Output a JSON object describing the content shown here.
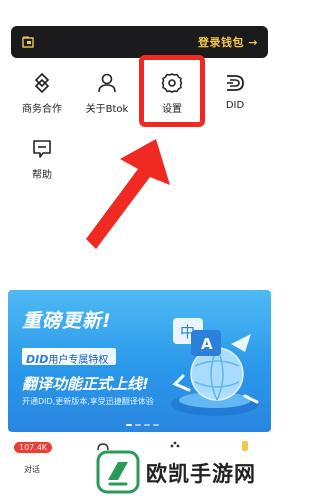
{
  "login_bar": {
    "text": "登录钱包 →"
  },
  "menu": [
    {
      "label": "商务合作",
      "icon": "diamond-icon"
    },
    {
      "label": "关于Btok",
      "icon": "person-icon"
    },
    {
      "label": "设置",
      "icon": "gear-icon"
    },
    {
      "label": "DID",
      "icon": "did-icon"
    },
    {
      "label": "帮助",
      "icon": "help-chat-icon"
    }
  ],
  "banner": {
    "title": "重磅更新!",
    "badge_did": "DID",
    "badge_rest": "用户专属特权",
    "headline": "翻译功能正式上线!",
    "subtext": "开通DID,更新版本,享受迅捷翻译体验",
    "art_text_zh": "中",
    "art_text_en": "A"
  },
  "tabbar": {
    "badge": "107.4K",
    "chat_label": "对话"
  },
  "watermark": {
    "text": "欧凯手游网"
  },
  "colors": {
    "highlight": "#f02a22",
    "login_text": "#f3c64e",
    "banner": "#2a98ea"
  }
}
